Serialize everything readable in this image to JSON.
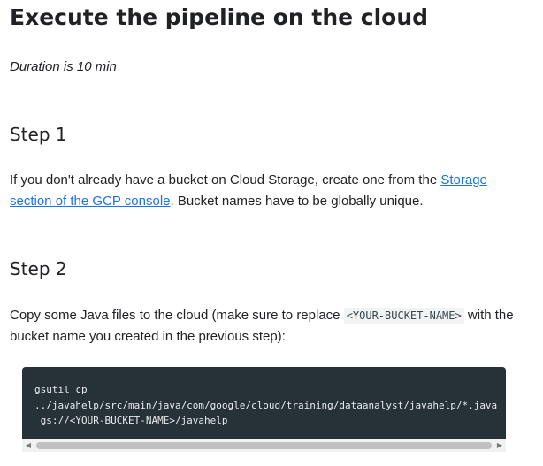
{
  "page": {
    "title": "Execute the pipeline on the cloud",
    "duration": "Duration is 10 min"
  },
  "step1": {
    "heading": "Step 1",
    "text_before": "If you don't already have a bucket on Cloud Storage, create one from the ",
    "link_text": "Storage section of the GCP console",
    "text_after": ". Bucket names have to be globally unique."
  },
  "step2": {
    "heading": "Step 2",
    "text_before": "Copy some Java files to the cloud (make sure to replace ",
    "inline_code": "<YOUR-BUCKET-NAME>",
    "text_after": " with the bucket name you created in the previous step):",
    "code": "gsutil cp\n../javahelp/src/main/java/com/google/cloud/training/dataanalyst/javahelp/*.java\n gs://<YOUR-BUCKET-NAME>/javahelp"
  },
  "scrollbar": {
    "left_arrow_icon": "triangle-left-icon",
    "right_arrow_icon": "triangle-right-icon"
  },
  "colors": {
    "link": "#1a73e8",
    "code_background": "#263238",
    "text": "#202124"
  }
}
